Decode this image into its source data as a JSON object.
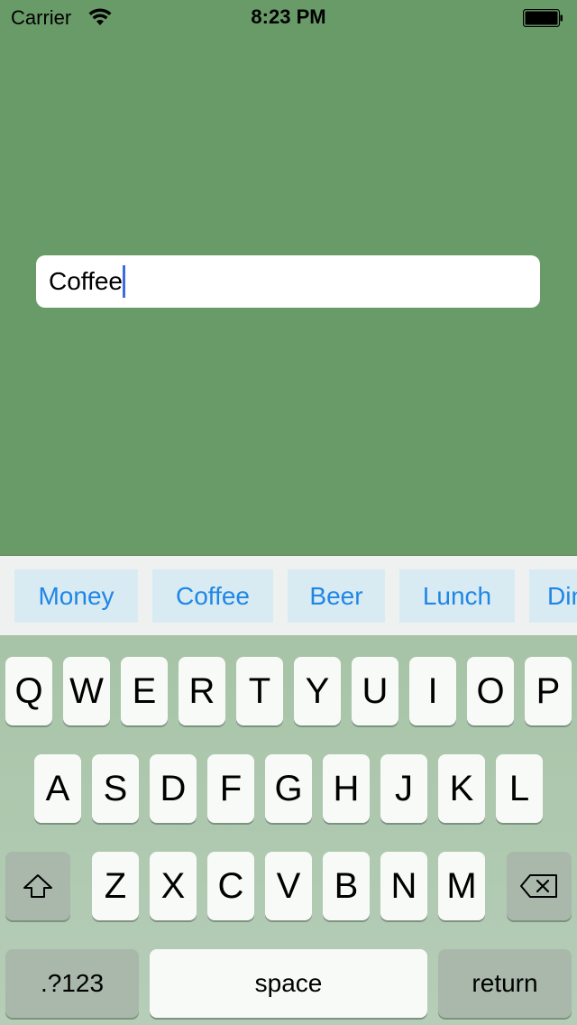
{
  "status_bar": {
    "carrier": "Carrier",
    "time": "8:23 PM"
  },
  "text_field": {
    "value": "Coffee"
  },
  "suggestions": [
    "Money",
    "Coffee",
    "Beer",
    "Lunch",
    "Dinner"
  ],
  "keyboard": {
    "row1": [
      "Q",
      "W",
      "E",
      "R",
      "T",
      "Y",
      "U",
      "I",
      "O",
      "P"
    ],
    "row2": [
      "A",
      "S",
      "D",
      "F",
      "G",
      "H",
      "J",
      "K",
      "L"
    ],
    "row3": [
      "Z",
      "X",
      "C",
      "V",
      "B",
      "N",
      "M"
    ],
    "numbers_label": ".?123",
    "space_label": "space",
    "return_label": "return"
  },
  "colors": {
    "background": "#699b68",
    "suggestion_text": "#2086e6",
    "suggestion_bg": "#d8ebf3",
    "caret": "#3c6ce0"
  }
}
